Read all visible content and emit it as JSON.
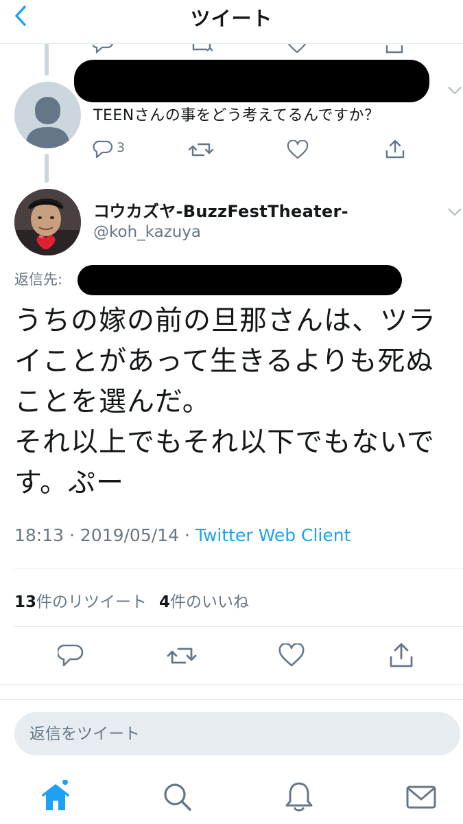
{
  "header": {
    "title": "ツイート"
  },
  "previous_tweet": {
    "text": "TEENさんの事をどう考えてるんですか？",
    "reply_count": "3"
  },
  "tweet": {
    "display_name": "コウカズヤ-BuzzFestTheater-",
    "handle": "@koh_kazuya",
    "reply_to_label": "返信先:",
    "body": "うちの嫁の前の旦那さんは、ツラ\nイことがあって生きるよりも死ぬ\nことを選んだ。\nそれ以上でもそれ以下でもないで\nす。ぷー",
    "time": "18:13",
    "date": "2019/05/14",
    "separator": " · ",
    "client": "Twitter Web Client",
    "retweets": {
      "count": "13",
      "label": "件のリツイート"
    },
    "likes": {
      "count": "4",
      "label": "件のいいね"
    }
  },
  "composer": {
    "placeholder": "返信をツイート"
  },
  "colors": {
    "accent": "#1da1f2",
    "secondary_text": "#657786",
    "icon_gray": "#657786",
    "divider": "#e1e8ed",
    "input_bg": "#e6ecf0"
  },
  "tabs": [
    {
      "icon": "home-icon",
      "active": true,
      "notification_dot": true
    },
    {
      "icon": "search-icon",
      "active": false
    },
    {
      "icon": "bell-icon",
      "active": false
    },
    {
      "icon": "mail-icon",
      "active": false
    }
  ]
}
